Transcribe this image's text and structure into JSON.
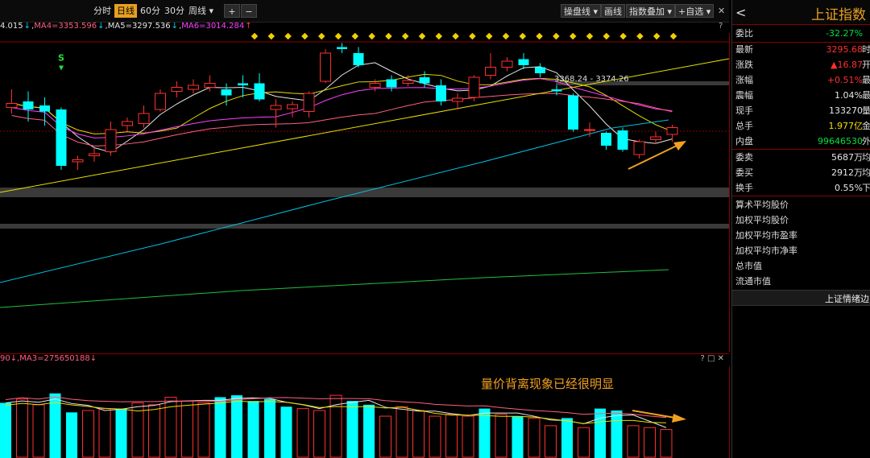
{
  "toolbar": {
    "tabs": [
      "分时",
      "日线",
      "60分",
      "30分",
      "周线 ▾"
    ],
    "active_tab": "日线",
    "zoom_in": "+",
    "zoom_out": "−",
    "dish_line": "操盘线 ▾",
    "draw_line": "画线",
    "index_overlay": "指数叠加 ▾",
    "add_watch": "+自选 ▾",
    "close": "✕",
    "help": "?"
  },
  "ma_line": {
    "ma3": "4.015",
    "ma4": "MA4=3353.596",
    "ma5": "MA5=3297.536",
    "ma6": "MA6=3014.284"
  },
  "main_chart": {
    "level_label": "3368.24 - 3374.26",
    "signal_letter": "S",
    "help": "?"
  },
  "volume": {
    "header": "90↓,MA3=275650188↓",
    "help_icons": "? □ ✕",
    "annotation": "量价背离现象已经很明显"
  },
  "right_panel": {
    "title": "上证指数",
    "back": "<",
    "rows": [
      {
        "label": "委比",
        "value": "-32.27%",
        "color": "green"
      },
      {
        "label": "最新",
        "value": "3295.68",
        "color": "red",
        "cut": "时"
      },
      {
        "label": "涨跌",
        "value": "▲16.87",
        "color": "red",
        "cut": "开"
      },
      {
        "label": "涨幅",
        "value": "+0.51%",
        "color": "red",
        "cut": "最"
      },
      {
        "label": "震幅",
        "value": "1.04%",
        "color": "white",
        "cut": "最"
      },
      {
        "label": "现手",
        "value": "133270",
        "color": "white",
        "cut": "量"
      },
      {
        "label": "总手",
        "value": "1.977亿",
        "color": "yellow",
        "cut": "金"
      },
      {
        "label": "内盘",
        "value": "99646530",
        "color": "green",
        "cut": "外"
      },
      {
        "label": "委卖",
        "value": "5687万",
        "color": "white",
        "cut": "均"
      },
      {
        "label": "委买",
        "value": "2912万",
        "color": "white",
        "cut": "均"
      },
      {
        "label": "换手",
        "value": "0.55%",
        "color": "white",
        "cut": "下"
      }
    ],
    "items": [
      "算术平均股价",
      "加权平均股价",
      "加权平均市盈率",
      "加权平均市净率",
      "总市值",
      "流通市值"
    ],
    "bottom_tab": "上证情绪边"
  },
  "colors": {
    "up": "#ff3030",
    "down": "#00ffff",
    "ma_white": "#e6e6e6",
    "ma_yellow": "#e8e000",
    "ma_magenta": "#ff40ff",
    "ma_pink": "#ff6080",
    "ma_cyan": "#00c0e0",
    "ma_green": "#20c040",
    "accent": "#e8a020"
  },
  "candles": [
    {
      "o": 3295,
      "c": 3305,
      "h": 3340,
      "l": 3280
    },
    {
      "o": 3310,
      "c": 3290,
      "h": 3335,
      "l": 3260
    },
    {
      "o": 3300,
      "c": 3285,
      "h": 3320,
      "l": 3250
    },
    {
      "o": 3290,
      "c": 3150,
      "h": 3295,
      "l": 3140,
      "signal": "S"
    },
    {
      "o": 3160,
      "c": 3165,
      "h": 3175,
      "l": 3140
    },
    {
      "o": 3175,
      "c": 3180,
      "h": 3195,
      "l": 3160
    },
    {
      "o": 3185,
      "c": 3240,
      "h": 3260,
      "l": 3175
    },
    {
      "o": 3250,
      "c": 3260,
      "h": 3270,
      "l": 3235
    },
    {
      "o": 3255,
      "c": 3280,
      "h": 3300,
      "l": 3245
    },
    {
      "o": 3290,
      "c": 3330,
      "h": 3340,
      "l": 3285
    },
    {
      "o": 3335,
      "c": 3345,
      "h": 3360,
      "l": 3320
    },
    {
      "o": 3340,
      "c": 3350,
      "h": 3365,
      "l": 3330
    },
    {
      "o": 3345,
      "c": 3355,
      "h": 3375,
      "l": 3335
    },
    {
      "o": 3340,
      "c": 3325,
      "h": 3355,
      "l": 3300
    },
    {
      "o": 3355,
      "c": 3350,
      "h": 3375,
      "l": 3320
    },
    {
      "o": 3355,
      "c": 3315,
      "h": 3380,
      "l": 3310
    },
    {
      "o": 3290,
      "c": 3300,
      "h": 3315,
      "l": 3245
    },
    {
      "o": 3292,
      "c": 3302,
      "h": 3310,
      "l": 3270
    },
    {
      "o": 3285,
      "c": 3330,
      "h": 3335,
      "l": 3270
    },
    {
      "o": 3360,
      "c": 3430,
      "h": 3440,
      "l": 3355
    },
    {
      "o": 3445,
      "c": 3440,
      "h": 3455,
      "l": 3430
    },
    {
      "o": 3430,
      "c": 3400,
      "h": 3445,
      "l": 3395
    },
    {
      "o": 3345,
      "c": 3355,
      "h": 3365,
      "l": 3335
    },
    {
      "o": 3365,
      "c": 3345,
      "h": 3375,
      "l": 3335
    },
    {
      "o": 3355,
      "c": 3362,
      "h": 3375,
      "l": 3348
    },
    {
      "o": 3370,
      "c": 3355,
      "h": 3385,
      "l": 3345
    },
    {
      "o": 3350,
      "c": 3310,
      "h": 3365,
      "l": 3300
    },
    {
      "o": 3310,
      "c": 3318,
      "h": 3330,
      "l": 3290
    },
    {
      "o": 3320,
      "c": 3370,
      "h": 3375,
      "l": 3310
    },
    {
      "o": 3375,
      "c": 3395,
      "h": 3430,
      "l": 3365
    },
    {
      "o": 3395,
      "c": 3410,
      "h": 3420,
      "l": 3385
    },
    {
      "o": 3415,
      "c": 3400,
      "h": 3430,
      "l": 3390
    },
    {
      "o": 3395,
      "c": 3380,
      "h": 3405,
      "l": 3370
    },
    {
      "o": 3340,
      "c": 3335,
      "h": 3350,
      "l": 3325
    },
    {
      "o": 3325,
      "c": 3240,
      "h": 3330,
      "l": 3235
    },
    {
      "o": 3238,
      "c": 3240,
      "h": 3258,
      "l": 3222
    },
    {
      "o": 3232,
      "c": 3200,
      "h": 3235,
      "l": 3190
    },
    {
      "o": 3238,
      "c": 3190,
      "h": 3245,
      "l": 3185
    },
    {
      "o": 3178,
      "c": 3210,
      "h": 3215,
      "l": 3168
    },
    {
      "o": 3215,
      "c": 3222,
      "h": 3235,
      "l": 3205
    },
    {
      "o": 3228,
      "c": 3245,
      "h": 3252,
      "l": 3210
    }
  ],
  "volumes": [
    {
      "v": 2.9,
      "up": false
    },
    {
      "v": 3.1,
      "up": true
    },
    {
      "v": 2.8,
      "up": true
    },
    {
      "v": 3.4,
      "up": false
    },
    {
      "v": 2.4,
      "up": false
    },
    {
      "v": 2.5,
      "up": true
    },
    {
      "v": 2.6,
      "up": true
    },
    {
      "v": 2.6,
      "up": false
    },
    {
      "v": 2.9,
      "up": true
    },
    {
      "v": 2.8,
      "up": true
    },
    {
      "v": 3.2,
      "up": true
    },
    {
      "v": 3.0,
      "up": true
    },
    {
      "v": 2.9,
      "up": true
    },
    {
      "v": 3.2,
      "up": false
    },
    {
      "v": 3.3,
      "up": false
    },
    {
      "v": 3.0,
      "up": false
    },
    {
      "v": 3.1,
      "up": false
    },
    {
      "v": 2.7,
      "up": false
    },
    {
      "v": 2.6,
      "up": true
    },
    {
      "v": 2.5,
      "up": true
    },
    {
      "v": 3.3,
      "up": true
    },
    {
      "v": 3.0,
      "up": false
    },
    {
      "v": 2.8,
      "up": false
    },
    {
      "v": 2.2,
      "up": true
    },
    {
      "v": 2.7,
      "up": true
    },
    {
      "v": 2.5,
      "up": true
    },
    {
      "v": 2.2,
      "up": true
    },
    {
      "v": 2.3,
      "up": true
    },
    {
      "v": 2.2,
      "up": true
    },
    {
      "v": 2.6,
      "up": false
    },
    {
      "v": 2.3,
      "up": true
    },
    {
      "v": 2.2,
      "up": false
    },
    {
      "v": 2.1,
      "up": true
    },
    {
      "v": 1.7,
      "up": true
    },
    {
      "v": 2.1,
      "up": false
    },
    {
      "v": 1.6,
      "up": true
    },
    {
      "v": 2.6,
      "up": false
    },
    {
      "v": 2.5,
      "up": false
    },
    {
      "v": 1.7,
      "up": true
    },
    {
      "v": 1.6,
      "up": true
    },
    {
      "v": 1.5,
      "up": true
    }
  ]
}
